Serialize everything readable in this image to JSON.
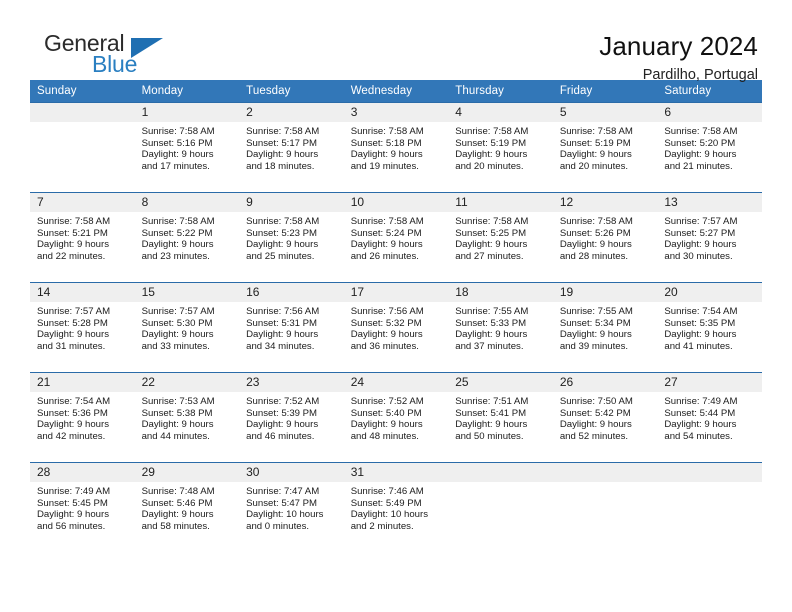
{
  "brand": {
    "word1": "General",
    "word2": "Blue",
    "logo_triangle": "triangle-icon",
    "accent_color": "#2a7fc1"
  },
  "header": {
    "title": "January 2024",
    "subtitle": "Pardilho, Portugal"
  },
  "theme": {
    "header_bar": "#3277b8",
    "daynum_band": "#efefef",
    "row_rule": "#2a6ba8"
  },
  "calendar": {
    "weekday_headers": [
      "Sunday",
      "Monday",
      "Tuesday",
      "Wednesday",
      "Thursday",
      "Friday",
      "Saturday"
    ],
    "weeks": [
      [
        {
          "day": "",
          "sunrise": "",
          "sunset": "",
          "daylight1": "",
          "daylight2": ""
        },
        {
          "day": "1",
          "sunrise": "Sunrise: 7:58 AM",
          "sunset": "Sunset: 5:16 PM",
          "daylight1": "Daylight: 9 hours",
          "daylight2": "and 17 minutes."
        },
        {
          "day": "2",
          "sunrise": "Sunrise: 7:58 AM",
          "sunset": "Sunset: 5:17 PM",
          "daylight1": "Daylight: 9 hours",
          "daylight2": "and 18 minutes."
        },
        {
          "day": "3",
          "sunrise": "Sunrise: 7:58 AM",
          "sunset": "Sunset: 5:18 PM",
          "daylight1": "Daylight: 9 hours",
          "daylight2": "and 19 minutes."
        },
        {
          "day": "4",
          "sunrise": "Sunrise: 7:58 AM",
          "sunset": "Sunset: 5:19 PM",
          "daylight1": "Daylight: 9 hours",
          "daylight2": "and 20 minutes."
        },
        {
          "day": "5",
          "sunrise": "Sunrise: 7:58 AM",
          "sunset": "Sunset: 5:19 PM",
          "daylight1": "Daylight: 9 hours",
          "daylight2": "and 20 minutes."
        },
        {
          "day": "6",
          "sunrise": "Sunrise: 7:58 AM",
          "sunset": "Sunset: 5:20 PM",
          "daylight1": "Daylight: 9 hours",
          "daylight2": "and 21 minutes."
        }
      ],
      [
        {
          "day": "7",
          "sunrise": "Sunrise: 7:58 AM",
          "sunset": "Sunset: 5:21 PM",
          "daylight1": "Daylight: 9 hours",
          "daylight2": "and 22 minutes."
        },
        {
          "day": "8",
          "sunrise": "Sunrise: 7:58 AM",
          "sunset": "Sunset: 5:22 PM",
          "daylight1": "Daylight: 9 hours",
          "daylight2": "and 23 minutes."
        },
        {
          "day": "9",
          "sunrise": "Sunrise: 7:58 AM",
          "sunset": "Sunset: 5:23 PM",
          "daylight1": "Daylight: 9 hours",
          "daylight2": "and 25 minutes."
        },
        {
          "day": "10",
          "sunrise": "Sunrise: 7:58 AM",
          "sunset": "Sunset: 5:24 PM",
          "daylight1": "Daylight: 9 hours",
          "daylight2": "and 26 minutes."
        },
        {
          "day": "11",
          "sunrise": "Sunrise: 7:58 AM",
          "sunset": "Sunset: 5:25 PM",
          "daylight1": "Daylight: 9 hours",
          "daylight2": "and 27 minutes."
        },
        {
          "day": "12",
          "sunrise": "Sunrise: 7:58 AM",
          "sunset": "Sunset: 5:26 PM",
          "daylight1": "Daylight: 9 hours",
          "daylight2": "and 28 minutes."
        },
        {
          "day": "13",
          "sunrise": "Sunrise: 7:57 AM",
          "sunset": "Sunset: 5:27 PM",
          "daylight1": "Daylight: 9 hours",
          "daylight2": "and 30 minutes."
        }
      ],
      [
        {
          "day": "14",
          "sunrise": "Sunrise: 7:57 AM",
          "sunset": "Sunset: 5:28 PM",
          "daylight1": "Daylight: 9 hours",
          "daylight2": "and 31 minutes."
        },
        {
          "day": "15",
          "sunrise": "Sunrise: 7:57 AM",
          "sunset": "Sunset: 5:30 PM",
          "daylight1": "Daylight: 9 hours",
          "daylight2": "and 33 minutes."
        },
        {
          "day": "16",
          "sunrise": "Sunrise: 7:56 AM",
          "sunset": "Sunset: 5:31 PM",
          "daylight1": "Daylight: 9 hours",
          "daylight2": "and 34 minutes."
        },
        {
          "day": "17",
          "sunrise": "Sunrise: 7:56 AM",
          "sunset": "Sunset: 5:32 PM",
          "daylight1": "Daylight: 9 hours",
          "daylight2": "and 36 minutes."
        },
        {
          "day": "18",
          "sunrise": "Sunrise: 7:55 AM",
          "sunset": "Sunset: 5:33 PM",
          "daylight1": "Daylight: 9 hours",
          "daylight2": "and 37 minutes."
        },
        {
          "day": "19",
          "sunrise": "Sunrise: 7:55 AM",
          "sunset": "Sunset: 5:34 PM",
          "daylight1": "Daylight: 9 hours",
          "daylight2": "and 39 minutes."
        },
        {
          "day": "20",
          "sunrise": "Sunrise: 7:54 AM",
          "sunset": "Sunset: 5:35 PM",
          "daylight1": "Daylight: 9 hours",
          "daylight2": "and 41 minutes."
        }
      ],
      [
        {
          "day": "21",
          "sunrise": "Sunrise: 7:54 AM",
          "sunset": "Sunset: 5:36 PM",
          "daylight1": "Daylight: 9 hours",
          "daylight2": "and 42 minutes."
        },
        {
          "day": "22",
          "sunrise": "Sunrise: 7:53 AM",
          "sunset": "Sunset: 5:38 PM",
          "daylight1": "Daylight: 9 hours",
          "daylight2": "and 44 minutes."
        },
        {
          "day": "23",
          "sunrise": "Sunrise: 7:52 AM",
          "sunset": "Sunset: 5:39 PM",
          "daylight1": "Daylight: 9 hours",
          "daylight2": "and 46 minutes."
        },
        {
          "day": "24",
          "sunrise": "Sunrise: 7:52 AM",
          "sunset": "Sunset: 5:40 PM",
          "daylight1": "Daylight: 9 hours",
          "daylight2": "and 48 minutes."
        },
        {
          "day": "25",
          "sunrise": "Sunrise: 7:51 AM",
          "sunset": "Sunset: 5:41 PM",
          "daylight1": "Daylight: 9 hours",
          "daylight2": "and 50 minutes."
        },
        {
          "day": "26",
          "sunrise": "Sunrise: 7:50 AM",
          "sunset": "Sunset: 5:42 PM",
          "daylight1": "Daylight: 9 hours",
          "daylight2": "and 52 minutes."
        },
        {
          "day": "27",
          "sunrise": "Sunrise: 7:49 AM",
          "sunset": "Sunset: 5:44 PM",
          "daylight1": "Daylight: 9 hours",
          "daylight2": "and 54 minutes."
        }
      ],
      [
        {
          "day": "28",
          "sunrise": "Sunrise: 7:49 AM",
          "sunset": "Sunset: 5:45 PM",
          "daylight1": "Daylight: 9 hours",
          "daylight2": "and 56 minutes."
        },
        {
          "day": "29",
          "sunrise": "Sunrise: 7:48 AM",
          "sunset": "Sunset: 5:46 PM",
          "daylight1": "Daylight: 9 hours",
          "daylight2": "and 58 minutes."
        },
        {
          "day": "30",
          "sunrise": "Sunrise: 7:47 AM",
          "sunset": "Sunset: 5:47 PM",
          "daylight1": "Daylight: 10 hours",
          "daylight2": "and 0 minutes."
        },
        {
          "day": "31",
          "sunrise": "Sunrise: 7:46 AM",
          "sunset": "Sunset: 5:49 PM",
          "daylight1": "Daylight: 10 hours",
          "daylight2": "and 2 minutes."
        },
        {
          "day": "",
          "sunrise": "",
          "sunset": "",
          "daylight1": "",
          "daylight2": ""
        },
        {
          "day": "",
          "sunrise": "",
          "sunset": "",
          "daylight1": "",
          "daylight2": ""
        },
        {
          "day": "",
          "sunrise": "",
          "sunset": "",
          "daylight1": "",
          "daylight2": ""
        }
      ]
    ]
  }
}
